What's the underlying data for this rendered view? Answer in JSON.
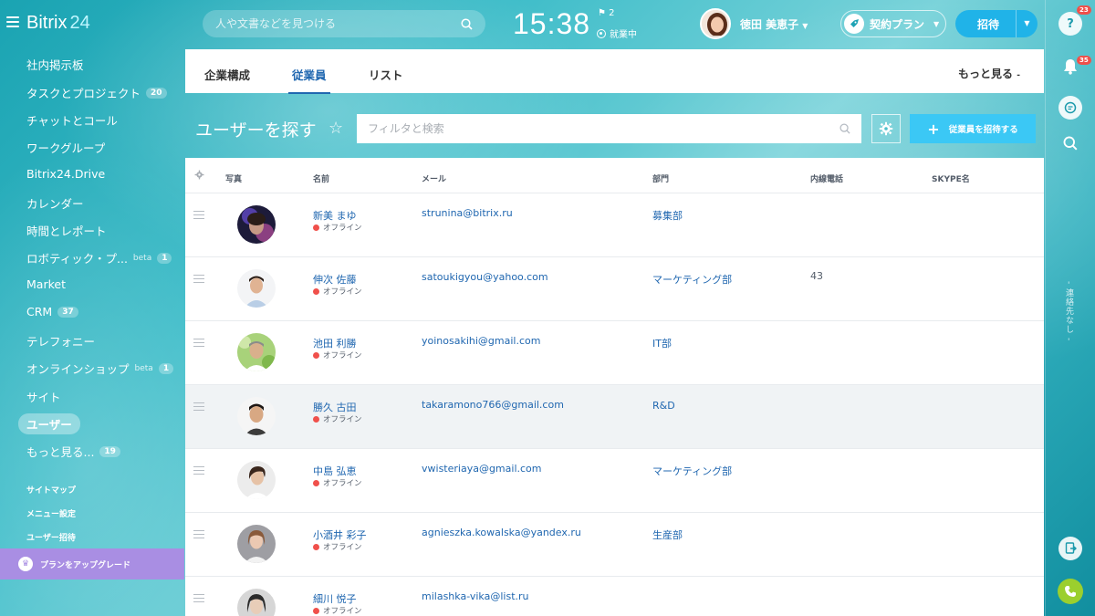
{
  "app": {
    "logo_text": "Bitrix",
    "logo_num": "24"
  },
  "header": {
    "search_placeholder": "人や文書などを見つける",
    "clock": "15:38",
    "flag_count": "2",
    "work_status": "就業中",
    "user_name": "徳田 美恵子",
    "plan_label": "契約プラン",
    "invite_label": "招待"
  },
  "sidebar": {
    "items": [
      {
        "label": "社内掲示板"
      },
      {
        "label": "タスクとプロジェクト",
        "badge": "20"
      },
      {
        "label": "チャットとコール"
      },
      {
        "label": "ワークグループ"
      },
      {
        "label": "Bitrix24.Drive"
      },
      {
        "label": "カレンダー"
      },
      {
        "label": "時間とレポート"
      },
      {
        "label": "ロボティック・プ...",
        "sup": "beta",
        "badge": "1"
      },
      {
        "label": "Market"
      },
      {
        "label": "CRM",
        "badge": "37"
      },
      {
        "label": "テレフォニー"
      },
      {
        "label": "オンラインショップ",
        "sup": "beta",
        "badge": "1"
      },
      {
        "label": "サイト"
      },
      {
        "label": "ユーザー"
      },
      {
        "label": "もっと見る...",
        "badge": "19"
      }
    ],
    "links": [
      "サイトマップ",
      "メニュー設定",
      "ユーザー招待"
    ],
    "upgrade_label": "プランをアップグレード"
  },
  "tabs": {
    "items": [
      "企業構成",
      "従業員",
      "リスト"
    ],
    "more": "もっと見る"
  },
  "toolbar": {
    "title": "ユーザーを探す",
    "filter_placeholder": "フィルタと検索",
    "add_label": "従業員を招待する"
  },
  "grid": {
    "columns": [
      "写真",
      "名前",
      "メール",
      "部門",
      "内線電話",
      "SKYPE名"
    ],
    "rows": [
      {
        "name": "新美 まゆ",
        "status": "オフライン",
        "email": "strunina@bitrix.ru",
        "dept": "募集部",
        "phone": ""
      },
      {
        "name": "伸次 佐藤",
        "status": "オフライン",
        "email": "satoukigyou@yahoo.com",
        "dept": "マーケティング部",
        "phone": "43"
      },
      {
        "name": "池田 利勝",
        "status": "オフライン",
        "email": "yoinosakihi@gmail.com",
        "dept": "IT部",
        "phone": ""
      },
      {
        "name": "勝久 古田",
        "status": "オフライン",
        "email": "takaramono766@gmail.com",
        "dept": "R&D",
        "phone": ""
      },
      {
        "name": "中島 弘恵",
        "status": "オフライン",
        "email": "vwisteriaya@gmail.com",
        "dept": "マーケティング部",
        "phone": ""
      },
      {
        "name": "小酒井 彩子",
        "status": "オフライン",
        "email": "agnieszka.kowalska@yandex.ru",
        "dept": "生産部",
        "phone": ""
      },
      {
        "name": "細川 悦子",
        "status": "オフライン",
        "email": "milashka-vika@list.ru",
        "dept": "",
        "phone": ""
      }
    ]
  },
  "rightrail": {
    "help_badge": "23",
    "notif_badge": "35",
    "vertical_text": "- 連絡先なし -"
  },
  "colors": {
    "accent": "#2067b0",
    "invite": "#20b3e8",
    "add": "#3bc8f5",
    "upgrade": "#a98ee3",
    "offline": "#f0504b",
    "call": "#9bcf2e"
  }
}
